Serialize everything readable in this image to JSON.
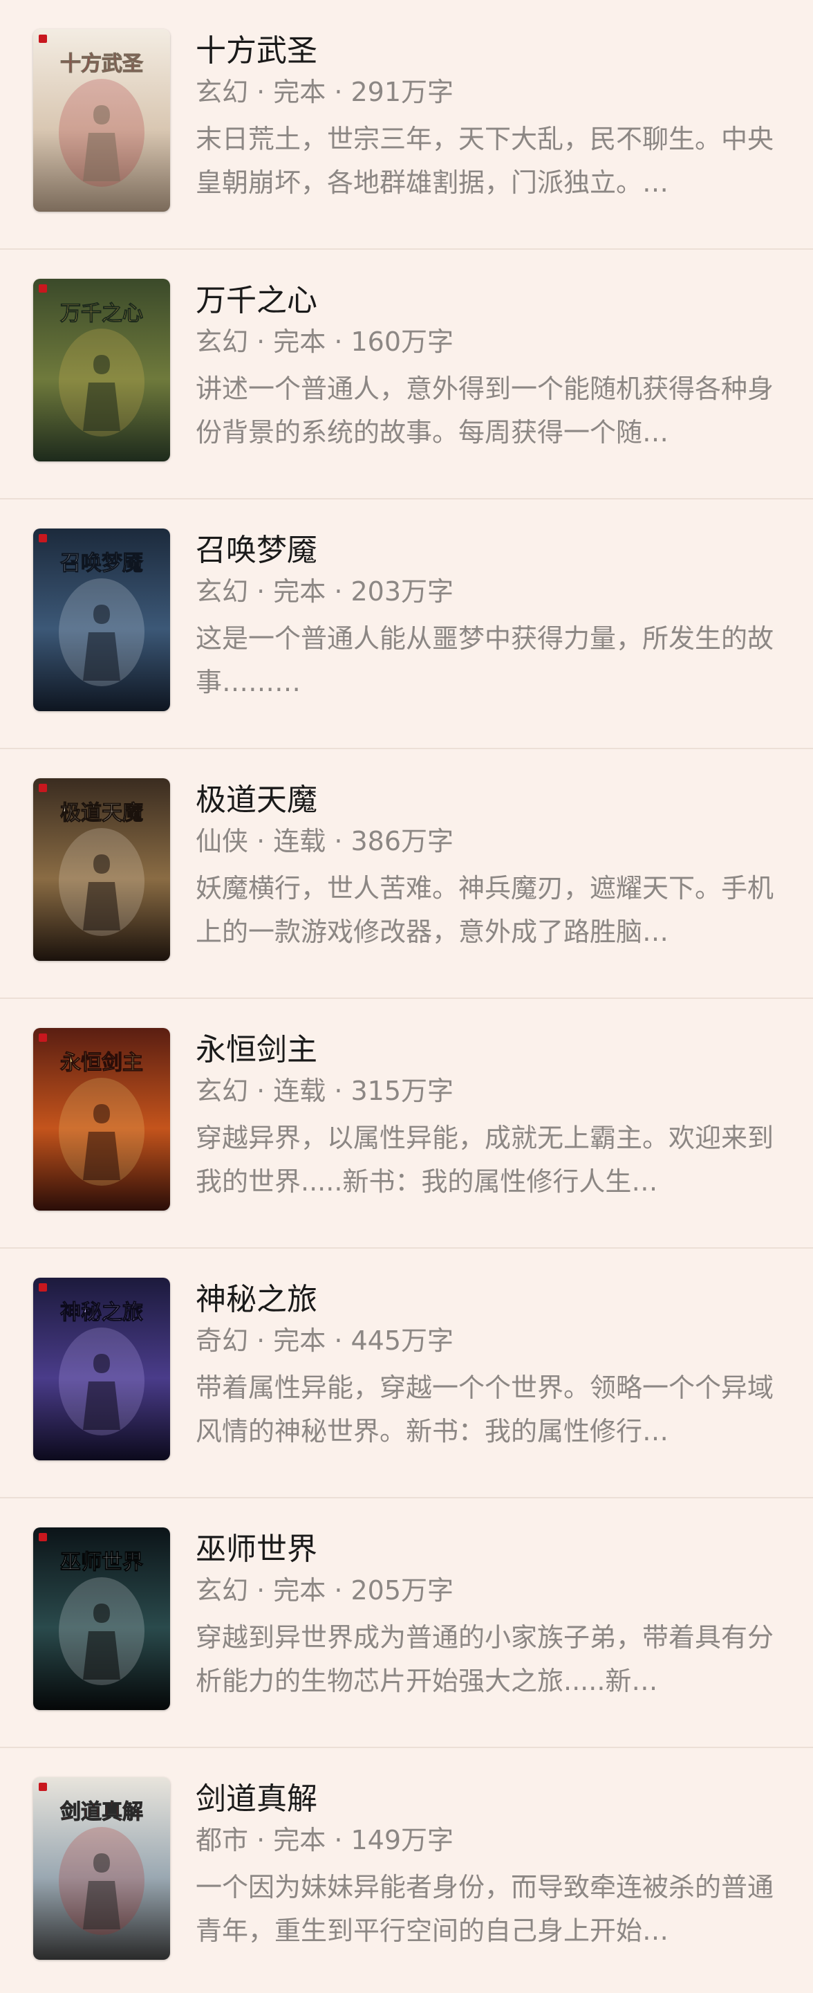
{
  "books": [
    {
      "title": "十方武圣",
      "meta": "玄幻 · 完本 · 291万字",
      "description": "末日荒土，世宗三年，天下大乱，民不聊生。中央皇朝崩坏，各地群雄割据，门派独立。…",
      "cover_text": "十方武圣",
      "cover_colors": [
        "#f3ece2",
        "#d9c7b2",
        "#a8202a",
        "#7a6a5a"
      ]
    },
    {
      "title": "万千之心",
      "meta": "玄幻 · 完本 · 160万字",
      "description": "讲述一个普通人，意外得到一个能随机获得各种身份背景的系统的故事。每周获得一个随…",
      "cover_text": "万千之心",
      "cover_colors": [
        "#3b4a2a",
        "#6f7a3c",
        "#e8c35a",
        "#1d2a1c"
      ]
    },
    {
      "title": "召唤梦魇",
      "meta": "玄幻 · 完本 · 203万字",
      "description": "这是一个普通人能从噩梦中获得力量，所发生的故事………",
      "cover_text": "召唤梦魇",
      "cover_colors": [
        "#1c2a3c",
        "#3c5877",
        "#dfe7f1",
        "#0e1520"
      ]
    },
    {
      "title": "极道天魔",
      "meta": "仙侠 · 连载 · 386万字",
      "description": "妖魔横行，世人苦难。神兵魔刃，遮耀天下。手机上的一款游戏修改器，意外成了路胜脑…",
      "cover_text": "极道天魔",
      "cover_colors": [
        "#3a2c20",
        "#8a6c44",
        "#f4e8d4",
        "#1b120c"
      ]
    },
    {
      "title": "永恒剑主",
      "meta": "玄幻 · 连载 · 315万字",
      "description": "穿越异界，以属性异能，成就无上霸主。欢迎来到我的世界.....新书：我的属性修行人生…",
      "cover_text": "永恒剑主",
      "cover_colors": [
        "#5a1e12",
        "#c4541c",
        "#f6d77a",
        "#2a0d08"
      ]
    },
    {
      "title": "神秘之旅",
      "meta": "奇幻 · 完本 · 445万字",
      "description": "带着属性异能，穿越一个个世界。领略一个个异域风情的神秘世界。新书：我的属性修行…",
      "cover_text": "神秘之旅",
      "cover_colors": [
        "#1c1a3c",
        "#4a3c8a",
        "#c8b6ff",
        "#0c0a1c"
      ]
    },
    {
      "title": "巫师世界",
      "meta": "玄幻 · 完本 · 205万字",
      "description": "穿越到异世界成为普通的小家族子弟，带着具有分析能力的生物芯片开始强大之旅.....新…",
      "cover_text": "巫师世界",
      "cover_colors": [
        "#0c1418",
        "#2a4a4c",
        "#e8eef0",
        "#050708"
      ]
    },
    {
      "title": "剑道真解",
      "meta": "都市 · 完本 · 149万字",
      "description": "一个因为妹妹异能者身份，而导致牵连被杀的普通青年，重生到平行空间的自己身上开始…",
      "cover_text": "剑道真解",
      "cover_colors": [
        "#e8e4dc",
        "#9aa8b2",
        "#b0201c",
        "#2a2a2a"
      ]
    }
  ]
}
